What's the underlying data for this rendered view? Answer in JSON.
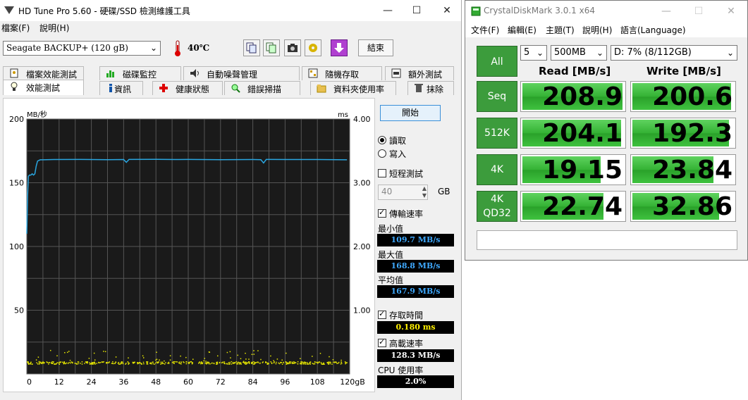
{
  "hdtune": {
    "title": "HD Tune Pro 5.60 - 硬碟/SSD 檢測維護工具",
    "menu": [
      "檔案(F)",
      "說明(H)"
    ],
    "drive": "Seagate BACKUP+ (120 gB)",
    "temperature": "40℃",
    "exit_label": "結束",
    "tabs_row1": [
      "檔案效能測試",
      "磁碟監控",
      "自動噪聲管理",
      "隨機存取",
      "額外測試"
    ],
    "tabs_row2": [
      "效能測試",
      "資訊",
      "健康狀態",
      "錯誤掃描",
      "資料夾使用率",
      "抹除"
    ],
    "start_label": "開始",
    "read_label": "讀取",
    "write_label": "寫入",
    "short_test_label": "短程測試",
    "short_test_value": "40",
    "gb_unit": "GB",
    "transfer_rate_label": "傳輸速率",
    "min_label": "最小值",
    "min_value": "109.7 MB/s",
    "max_label": "最大值",
    "max_value": "168.8 MB/s",
    "avg_label": "平均值",
    "avg_value": "167.9 MB/s",
    "access_time_label": "存取時間",
    "access_time_value": "0.180 ms",
    "burst_rate_label": "高載速率",
    "burst_rate_value": "128.3 MB/s",
    "cpu_label": "CPU 使用率",
    "cpu_value": "2.0%"
  },
  "chart_data": {
    "type": "line",
    "left_unit": "MB/秒",
    "right_unit": "ms",
    "x_ticks": [
      "0",
      "12",
      "24",
      "36",
      "48",
      "60",
      "72",
      "84",
      "96",
      "108",
      "120gB"
    ],
    "y_left_ticks": [
      "200",
      "150",
      "100",
      "50"
    ],
    "y_right_ticks": [
      "4.00",
      "3.00",
      "2.00",
      "1.00"
    ],
    "ylim_left": [
      0,
      200
    ],
    "ylim_right": [
      0,
      4
    ],
    "xlim": [
      0,
      120
    ],
    "grid": true,
    "series": [
      {
        "name": "傳輸速率",
        "color": "#2aa6e0",
        "x": [
          0,
          0.3,
          0.6,
          1,
          1.5,
          2,
          2.5,
          3,
          3.5,
          4,
          5,
          6,
          10,
          20,
          30,
          36,
          37,
          38,
          48,
          55,
          60,
          72,
          84,
          87,
          88,
          89,
          96,
          108,
          119
        ],
        "y": [
          110,
          140,
          155,
          156,
          156,
          157,
          156,
          157,
          163,
          167,
          168,
          168,
          168.2,
          168.3,
          168.1,
          168.2,
          166,
          168.3,
          168.4,
          168.2,
          168.3,
          168.1,
          168.2,
          168.1,
          165.5,
          168.3,
          168.2,
          168.2,
          168
        ]
      },
      {
        "name": "存取時間",
        "color": "#e8e800",
        "type": "scatter",
        "typical_ms": 0.18
      }
    ]
  },
  "cdm": {
    "title": "CrystalDiskMark 3.0.1 x64",
    "menu": [
      "文件(F)",
      "編輯(E)",
      "主題(T)",
      "說明(H)",
      "語言(Language)"
    ],
    "all_label": "All",
    "count": "5",
    "size": "500MB",
    "drive": "D: 7% (8/112GB)",
    "read_header": "Read [MB/s]",
    "write_header": "Write [MB/s]",
    "rows": [
      {
        "label": "Seq",
        "read": "208.9",
        "write": "200.6",
        "read_frac": 0.97,
        "write_frac": 0.96
      },
      {
        "label": "512K",
        "read": "204.1",
        "write": "192.3",
        "read_frac": 0.96,
        "write_frac": 0.94
      },
      {
        "label": "4K",
        "read": "19.15",
        "write": "23.84",
        "read_frac": 0.76,
        "write_frac": 0.79
      },
      {
        "label": "4K\nQD32",
        "read": "22.74",
        "write": "32.86",
        "read_frac": 0.79,
        "write_frac": 0.84
      }
    ]
  }
}
